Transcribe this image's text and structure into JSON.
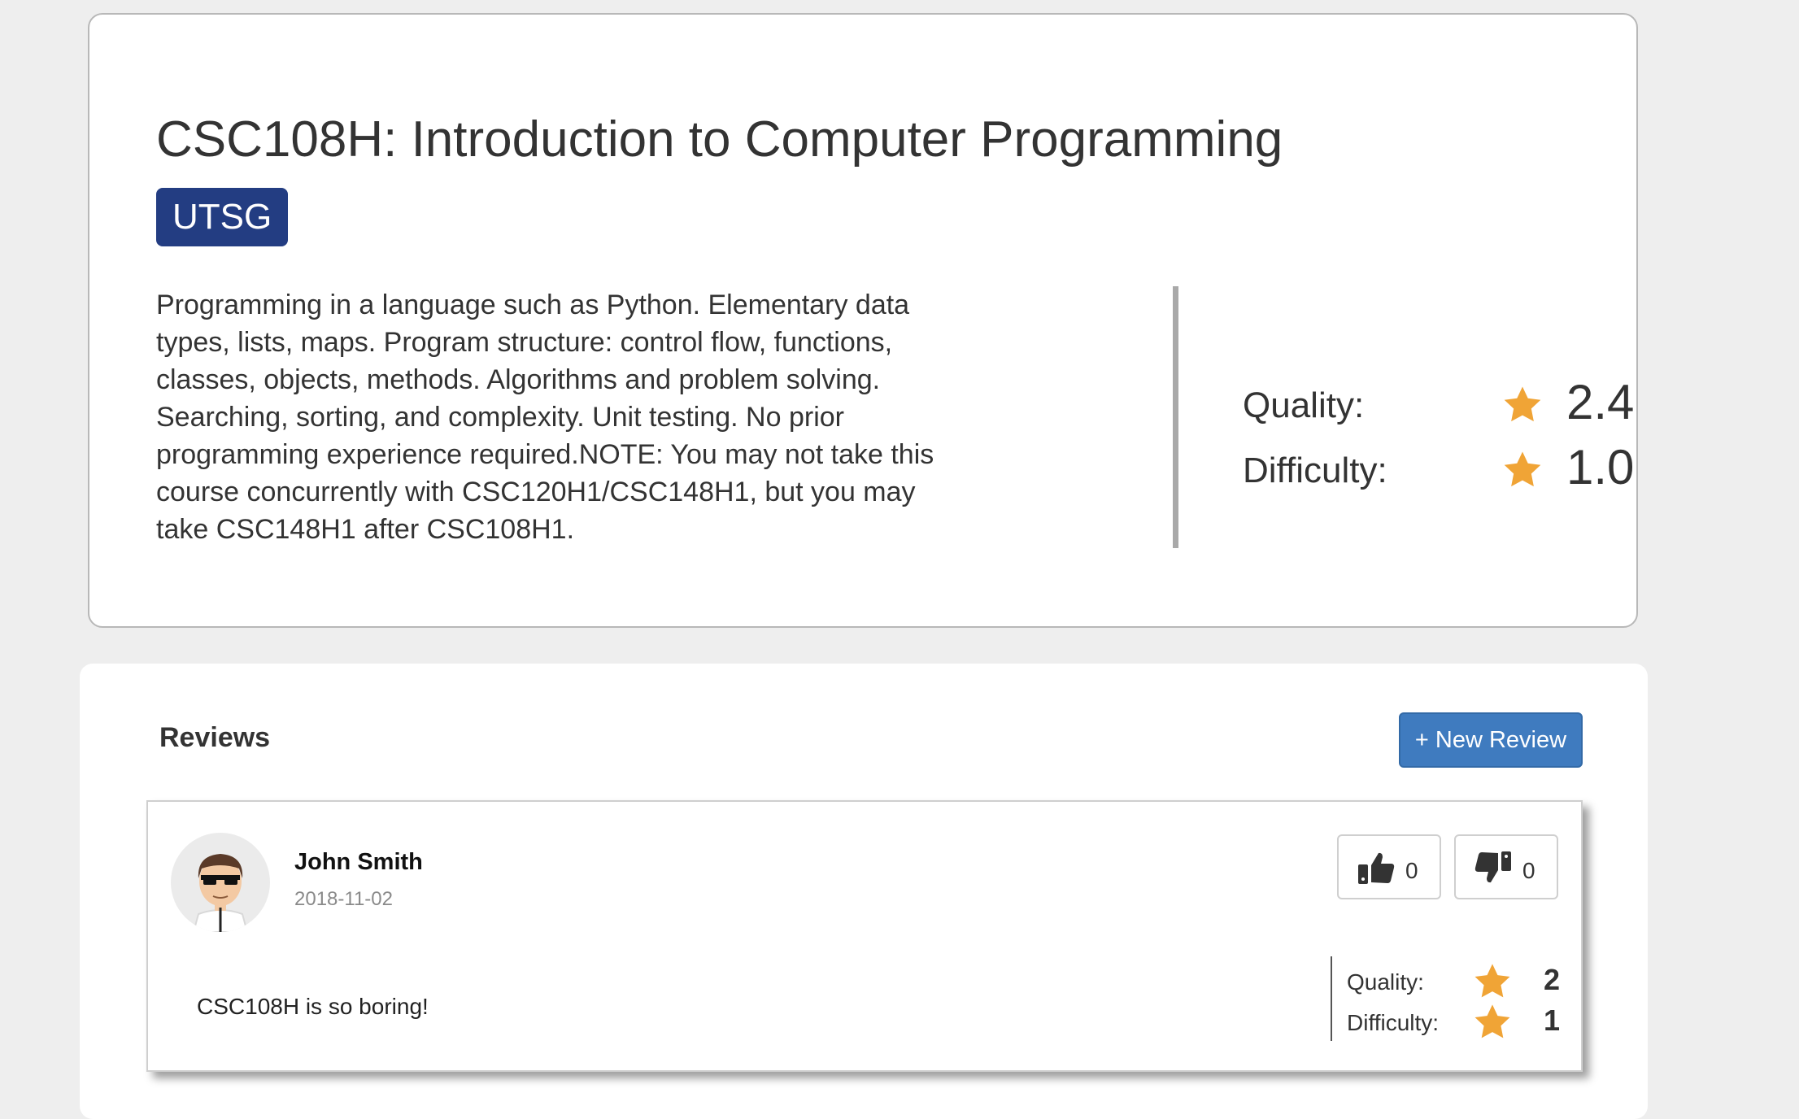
{
  "course": {
    "title": "CSC108H: Introduction to Computer Programming",
    "campus": "UTSG",
    "description": "Programming in a language such as Python. Elementary data types, lists, maps.  Program structure: control flow, functions, classes, objects, methods. Algorithms and problem solving. Searching, sorting, and complexity. Unit testing. No prior programming experience required.NOTE: You may not take this course concurrently with CSC120H1/CSC148H1, but you may take CSC148H1 after CSC108H1.",
    "quality_label": "Quality:",
    "quality_value": "2.4",
    "difficulty_label": "Difficulty:",
    "difficulty_value": "1.0",
    "star_icon": "star-icon"
  },
  "reviews": {
    "heading": "Reviews",
    "new_review_label": "+ New Review",
    "items": [
      {
        "name": "John Smith",
        "date": "2018-11-02",
        "text": "CSC108H is so boring!",
        "upvotes": "0",
        "downvotes": "0",
        "quality_label": "Quality:",
        "quality_value": "2",
        "difficulty_label": "Difficulty:",
        "difficulty_value": "1"
      }
    ]
  },
  "colors": {
    "background": "#eeeeee",
    "badge": "#233d82",
    "button": "#3f7bbf",
    "star": "#f0a436",
    "text": "#333333"
  }
}
